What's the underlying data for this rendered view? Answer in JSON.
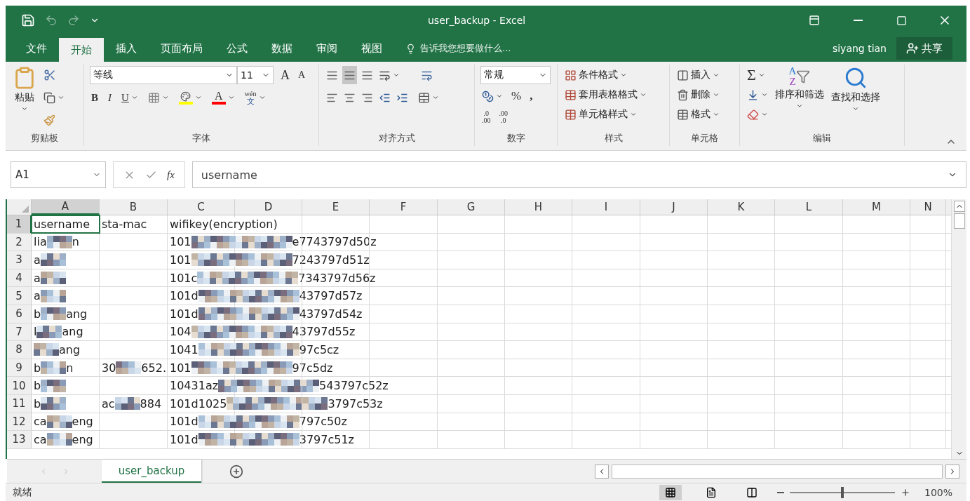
{
  "window": {
    "title": "user_backup - Excel",
    "user": "siyang tian",
    "share": "共享"
  },
  "tabs": [
    {
      "label": "文件",
      "selected": false
    },
    {
      "label": "开始",
      "selected": true
    },
    {
      "label": "插入",
      "selected": false
    },
    {
      "label": "页面布局",
      "selected": false
    },
    {
      "label": "公式",
      "selected": false
    },
    {
      "label": "数据",
      "selected": false
    },
    {
      "label": "审阅",
      "selected": false
    },
    {
      "label": "视图",
      "selected": false
    }
  ],
  "tell_me": "告诉我您想要做什么...",
  "ribbon": {
    "clipboard": {
      "paste": "粘贴",
      "label": "剪贴板"
    },
    "font": {
      "name": "等线",
      "size": "11",
      "grow": "A",
      "shrink": "A",
      "bold": "B",
      "italic": "I",
      "underline": "U",
      "font_color": "A",
      "phonetic_top": "wén",
      "phonetic_bottom": "文",
      "label": "字体"
    },
    "alignment": {
      "label": "对齐方式"
    },
    "number": {
      "format": "常规",
      "percent": "%",
      "comma": ",",
      "inc_top": ".0",
      "inc_bottom": ".00",
      "dec_top": ".00",
      "dec_bottom": ".0",
      "label": "数字"
    },
    "styles": {
      "items": [
        "条件格式",
        "套用表格格式",
        "单元格样式"
      ],
      "label": "样式"
    },
    "cells": {
      "items": [
        "插入",
        "删除",
        "格式"
      ],
      "label": "单元格"
    },
    "editing": {
      "sigma": "Σ",
      "sort_letters": [
        "A",
        "Z"
      ],
      "sort": "排序和筛选",
      "find": "查找和选择",
      "label": "编辑"
    }
  },
  "formula_bar": {
    "name_box": "A1",
    "fx": "fx",
    "value": "username"
  },
  "columns": [
    {
      "label": "A",
      "selected": true
    },
    {
      "label": "B",
      "selected": false
    },
    {
      "label": "C",
      "selected": false
    },
    {
      "label": "D",
      "selected": false
    },
    {
      "label": "E",
      "selected": false
    },
    {
      "label": "F",
      "selected": false
    },
    {
      "label": "G",
      "selected": false
    },
    {
      "label": "H",
      "selected": false
    },
    {
      "label": "I",
      "selected": false
    },
    {
      "label": "J",
      "selected": false
    },
    {
      "label": "K",
      "selected": false
    },
    {
      "label": "L",
      "selected": false
    },
    {
      "label": "M",
      "selected": false
    },
    {
      "label": "N",
      "selected": false
    }
  ],
  "rows": [
    {
      "number": "1",
      "selected": true,
      "cells": [
        {
          "head": "username"
        },
        {
          "head": "sta-mac"
        },
        {
          "head": "wifikey(encryption)"
        }
      ]
    },
    {
      "number": "2",
      "selected": false,
      "cells": [
        {
          "head": "lia",
          "tail": "n",
          "redacted": true
        },
        null,
        {
          "head": "101",
          "tail": "e7743797d50z",
          "redacted": true
        }
      ]
    },
    {
      "number": "3",
      "selected": false,
      "cells": [
        {
          "head": "a",
          "redacted": true
        },
        null,
        {
          "head": "101",
          "tail": "7243797d51z",
          "redacted": true
        }
      ]
    },
    {
      "number": "4",
      "selected": false,
      "cells": [
        {
          "head": "a",
          "redacted": true
        },
        null,
        {
          "head": "101c",
          "tail": "7343797d56z",
          "redacted": true
        }
      ]
    },
    {
      "number": "5",
      "selected": false,
      "cells": [
        {
          "head": "a",
          "redacted": true
        },
        null,
        {
          "head": "101d",
          "tail": "43797d57z",
          "redacted": true
        }
      ]
    },
    {
      "number": "6",
      "selected": false,
      "cells": [
        {
          "head": "b",
          "tail": "ang",
          "redacted": true
        },
        null,
        {
          "head": "101d",
          "tail": "43797d54z",
          "redacted": true
        }
      ]
    },
    {
      "number": "7",
      "selected": false,
      "cells": [
        {
          "head": "l",
          "tail": "ang",
          "redacted": true
        },
        null,
        {
          "head": "104",
          "tail": "43797d55z",
          "redacted": true
        }
      ]
    },
    {
      "number": "8",
      "selected": false,
      "cells": [
        {
          "tail": "ang",
          "redacted": true
        },
        null,
        {
          "head": "1041",
          "tail": "97c5cz",
          "redacted": true
        }
      ]
    },
    {
      "number": "9",
      "selected": false,
      "cells": [
        {
          "head": "b",
          "tail": "n",
          "redacted": true
        },
        {
          "head": "30",
          "tail": "652.",
          "redacted": true
        },
        {
          "head": "101",
          "tail": "97c5dz",
          "redacted": true
        }
      ]
    },
    {
      "number": "10",
      "selected": false,
      "cells": [
        {
          "head": "b",
          "redacted": true
        },
        null,
        {
          "head": "10431az",
          "tail": "543797c52z",
          "redacted": true
        }
      ]
    },
    {
      "number": "11",
      "selected": false,
      "cells": [
        {
          "head": "b",
          "redacted": true
        },
        {
          "head": "ac",
          "tail": "884",
          "redacted": true
        },
        {
          "head": "101d1025",
          "tail": "3797c53z",
          "redacted": true
        }
      ]
    },
    {
      "number": "12",
      "selected": false,
      "cells": [
        {
          "head": "ca",
          "tail": "eng",
          "redacted": true
        },
        null,
        {
          "head": "101d",
          "tail": "797c50z",
          "redacted": true
        }
      ]
    },
    {
      "number": "13",
      "selected": false,
      "cells": [
        {
          "head": "ca",
          "tail": "eng",
          "redacted": true
        },
        null,
        {
          "head": "101d",
          "tail": "3797c51z",
          "redacted": true
        }
      ]
    }
  ],
  "sheet_tabs": [
    {
      "label": "user_backup",
      "selected": true
    }
  ],
  "status_bar": {
    "text": "就绪",
    "zoom": "100%",
    "zoom_level": {
      "level": 0.5
    }
  }
}
